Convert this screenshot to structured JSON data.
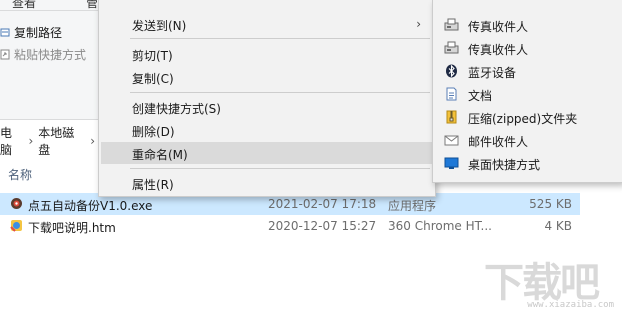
{
  "ribbon": {
    "tabs": [
      "查看",
      "管"
    ],
    "buttons": [
      {
        "label": "复制路径"
      },
      {
        "label": "粘贴快捷方式"
      }
    ]
  },
  "address": {
    "segments": [
      "电脑",
      "本地磁盘"
    ]
  },
  "file_list": {
    "column_name": "名称",
    "rows": [
      {
        "name": "点五自动备份V1.0.exe",
        "date": "2021-02-07 17:18",
        "type": "应用程序",
        "size": "525 KB",
        "selected": true
      },
      {
        "name": "下载吧说明.htm",
        "date": "2020-12-07 15:27",
        "type": "360 Chrome HT...",
        "size": "4 KB",
        "selected": false
      }
    ]
  },
  "context_menu": {
    "items": [
      {
        "label": "发送到(N)",
        "has_submenu": true
      },
      {
        "label": "剪切(T)"
      },
      {
        "label": "复制(C)"
      },
      {
        "label": "创建快捷方式(S)"
      },
      {
        "label": "删除(D)"
      },
      {
        "label": "重命名(M)",
        "highlighted": true
      },
      {
        "label": "属性(R)"
      }
    ]
  },
  "send_to_submenu": {
    "items": [
      {
        "label": "传真收件人",
        "icon": "fax-icon"
      },
      {
        "label": "传真收件人",
        "icon": "fax-icon"
      },
      {
        "label": "蓝牙设备",
        "icon": "bluetooth-icon"
      },
      {
        "label": "文档",
        "icon": "document-icon"
      },
      {
        "label": "压缩(zipped)文件夹",
        "icon": "zip-folder-icon"
      },
      {
        "label": "邮件收件人",
        "icon": "mail-icon"
      },
      {
        "label": "桌面快捷方式",
        "icon": "desktop-icon"
      }
    ]
  },
  "watermark": {
    "logo_text": "下载吧",
    "url": "www.xiazaiba.com"
  },
  "colors": {
    "selection": "#cce8ff",
    "menu_bg": "#f2f2f2",
    "menu_highlight": "#dadada"
  }
}
